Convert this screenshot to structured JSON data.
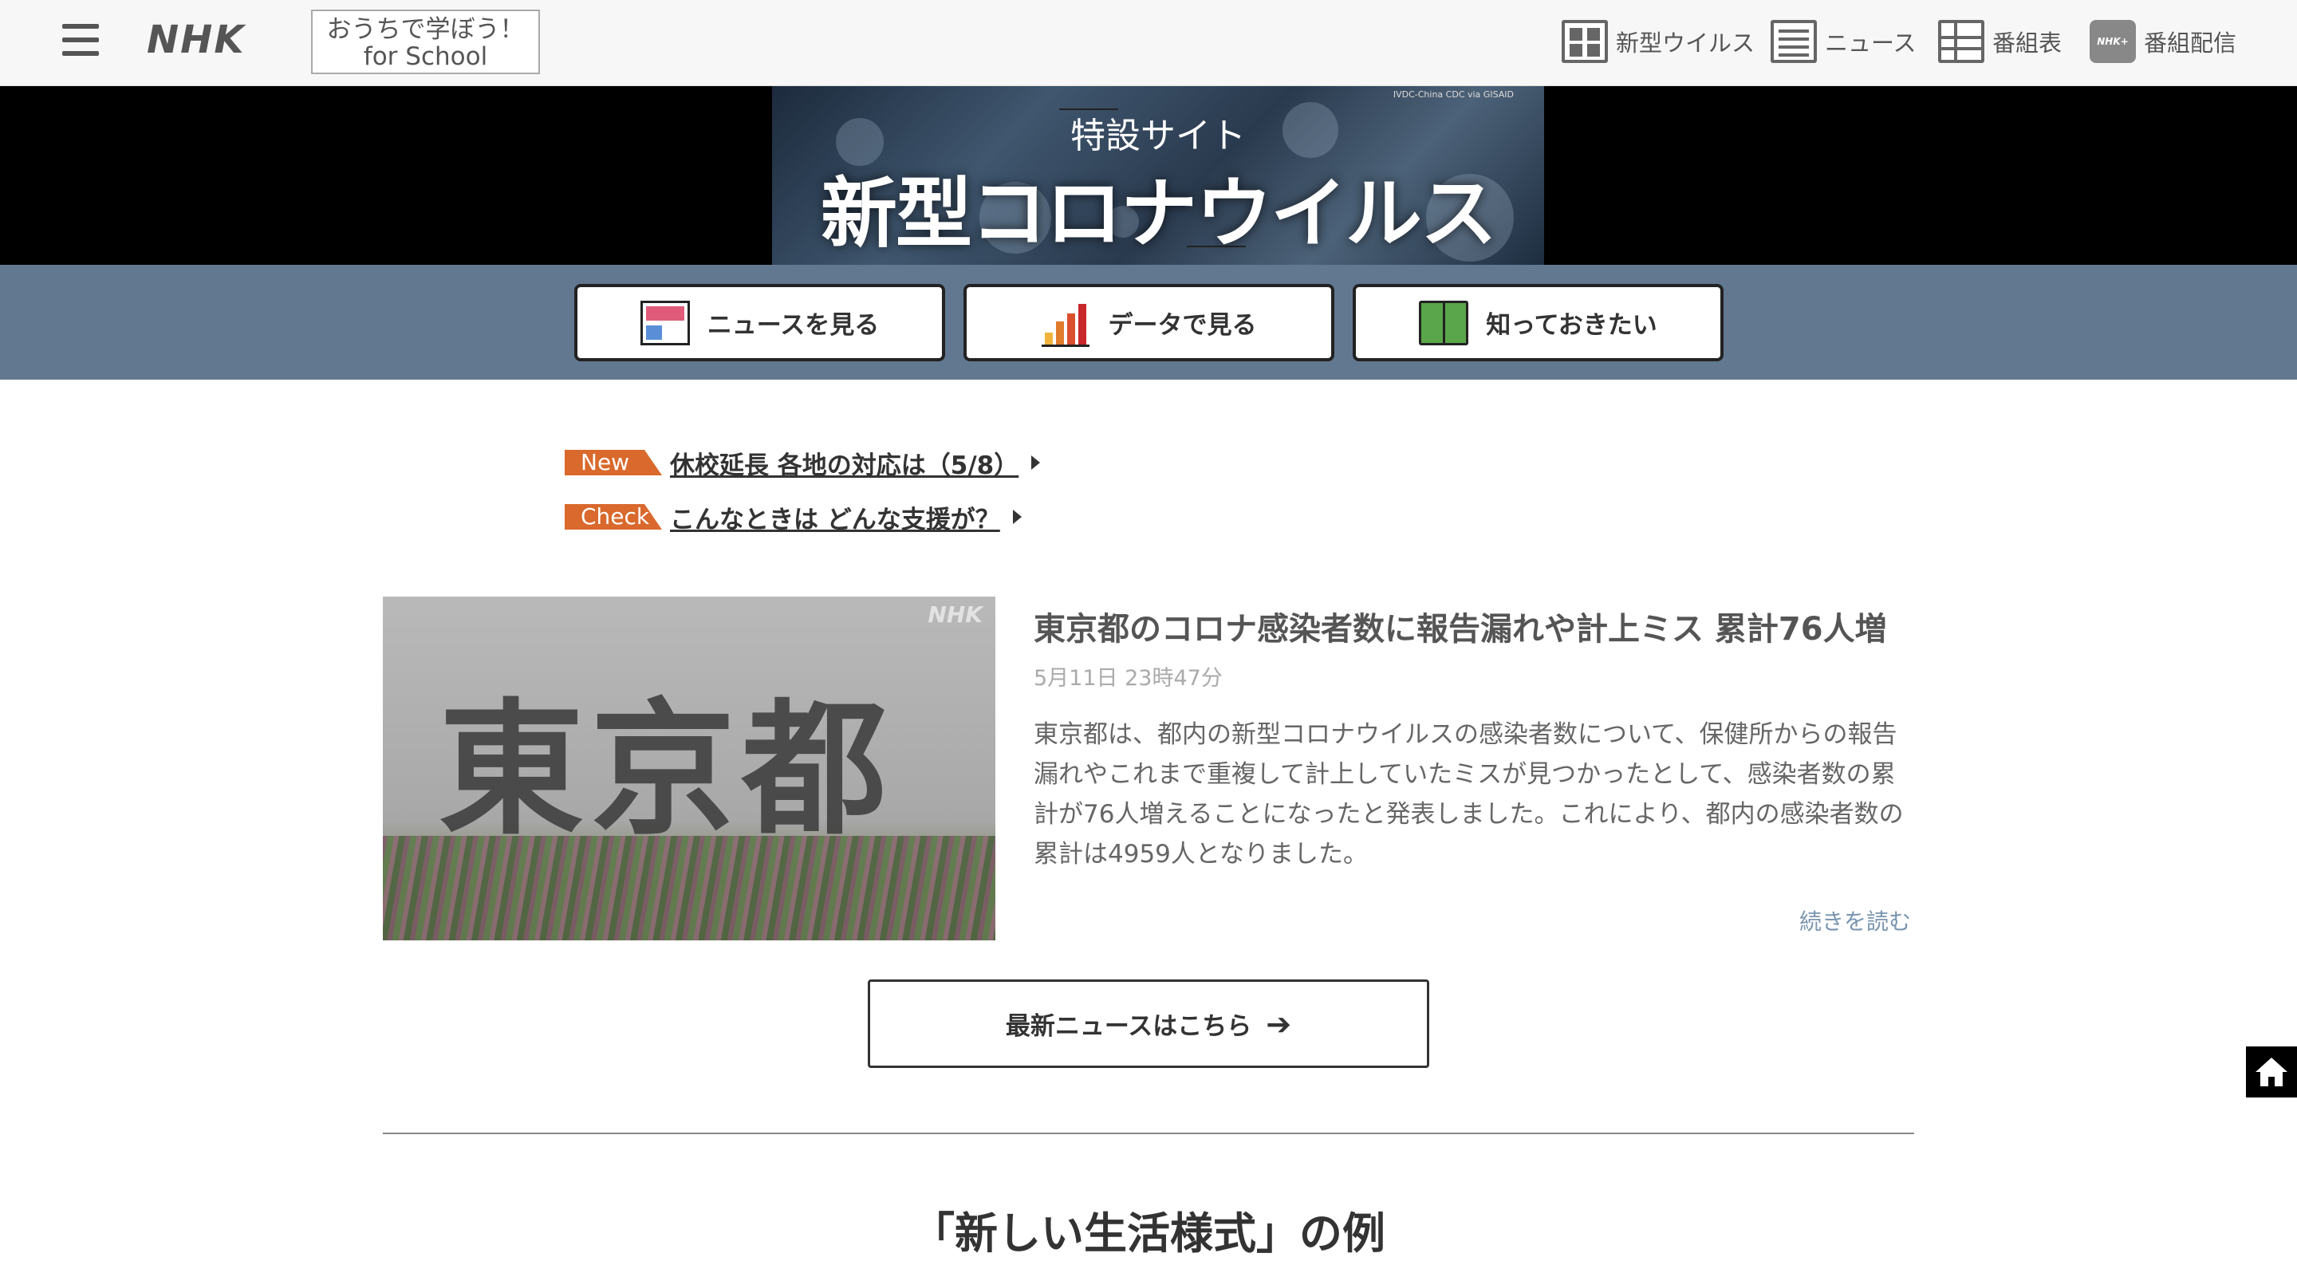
{
  "header": {
    "logo": "NHK",
    "school_line1": "おうちで学ぼう！",
    "school_line2": "for School",
    "nav": [
      {
        "label": "新型ウイルス",
        "icon": "virus-grid-icon"
      },
      {
        "label": "ニュース",
        "icon": "news-icon"
      },
      {
        "label": "番組表",
        "icon": "program-grid-icon"
      },
      {
        "label": "番組配信",
        "icon": "nhk-plus-icon"
      }
    ]
  },
  "banner": {
    "credit": "IVDC-China CDC via GISAID",
    "subtitle": "特設サイト",
    "title": "新型コロナウイルス"
  },
  "buttons": [
    {
      "label": "ニュースを見る",
      "icon": "news-screen-icon"
    },
    {
      "label": "データで見る",
      "icon": "bar-chart-icon"
    },
    {
      "label": "知っておきたい",
      "icon": "open-book-icon"
    }
  ],
  "quick_links": [
    {
      "badge": "New",
      "text": "休校延長 各地の対応は（5/8）"
    },
    {
      "badge": "Check",
      "text": "こんなときは どんな支援が？"
    }
  ],
  "article": {
    "image_text": "東京都",
    "image_watermark": "NHK",
    "title": "東京都のコロナ感染者数に報告漏れや計上ミス 累計76人増",
    "date": "5月11日 23時47分",
    "body": "東京都は、都内の新型コロナウイルスの感染者数について、保健所からの報告漏れやこれまで重複して計上していたミスが見つかったとして、感染者数の累計が76人増えることになったと発表しました。これにより、都内の感染者数の累計は4959人となりました。",
    "more": "続きを読む"
  },
  "latest_button": "最新ニュースはこちら",
  "section_title": "「新しい生活様式」の例",
  "colors": {
    "strip": "#627890",
    "badge": "#d9692c",
    "link_more": "#7a95b0"
  }
}
